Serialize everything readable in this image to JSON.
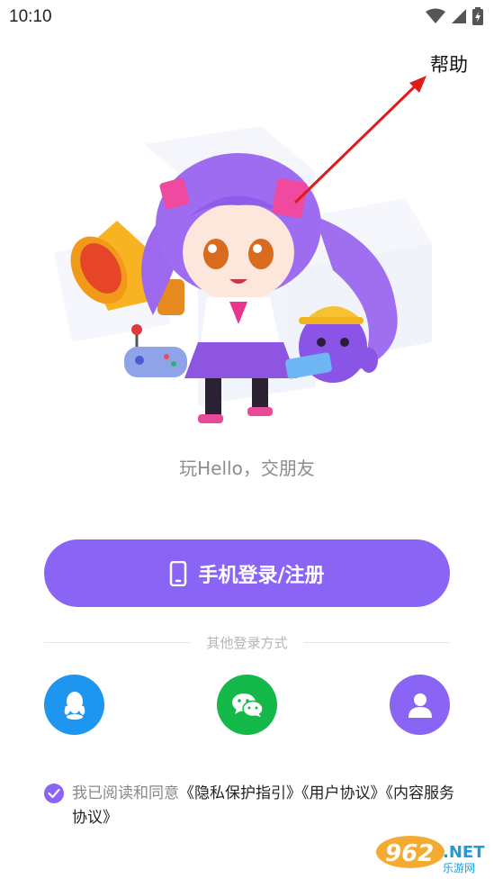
{
  "status_bar": {
    "time": "10:10",
    "icons": [
      "wifi-icon",
      "signal-icon",
      "battery-charging-icon"
    ]
  },
  "header": {
    "help_label": "帮助"
  },
  "hero": {
    "illustration": "mascot-girl-with-megaphone-and-purple-creature"
  },
  "slogan": "玩Hello，交朋友",
  "login": {
    "button_label": "手机登录/注册",
    "icon": "phone-icon"
  },
  "other_login": {
    "divider_label": "其他登录方式",
    "options": [
      {
        "name": "qq",
        "icon": "qq-icon",
        "color": "#1e96f0"
      },
      {
        "name": "wechat",
        "icon": "wechat-icon",
        "color": "#14b94a"
      },
      {
        "name": "guest",
        "icon": "user-icon",
        "color": "#8a65f5"
      }
    ]
  },
  "agreement": {
    "checked": true,
    "prefix": "我已阅读和同意",
    "links": [
      "《隐私保护指引》",
      "《用户协议》",
      "《内容服务协议》"
    ]
  },
  "watermark": {
    "brand": "962",
    "suffix": ".NET",
    "subtitle": "乐游网"
  },
  "colors": {
    "accent": "#8a65f5",
    "qq": "#1e96f0",
    "wechat": "#14b94a",
    "annotation": "#e01b1b"
  }
}
